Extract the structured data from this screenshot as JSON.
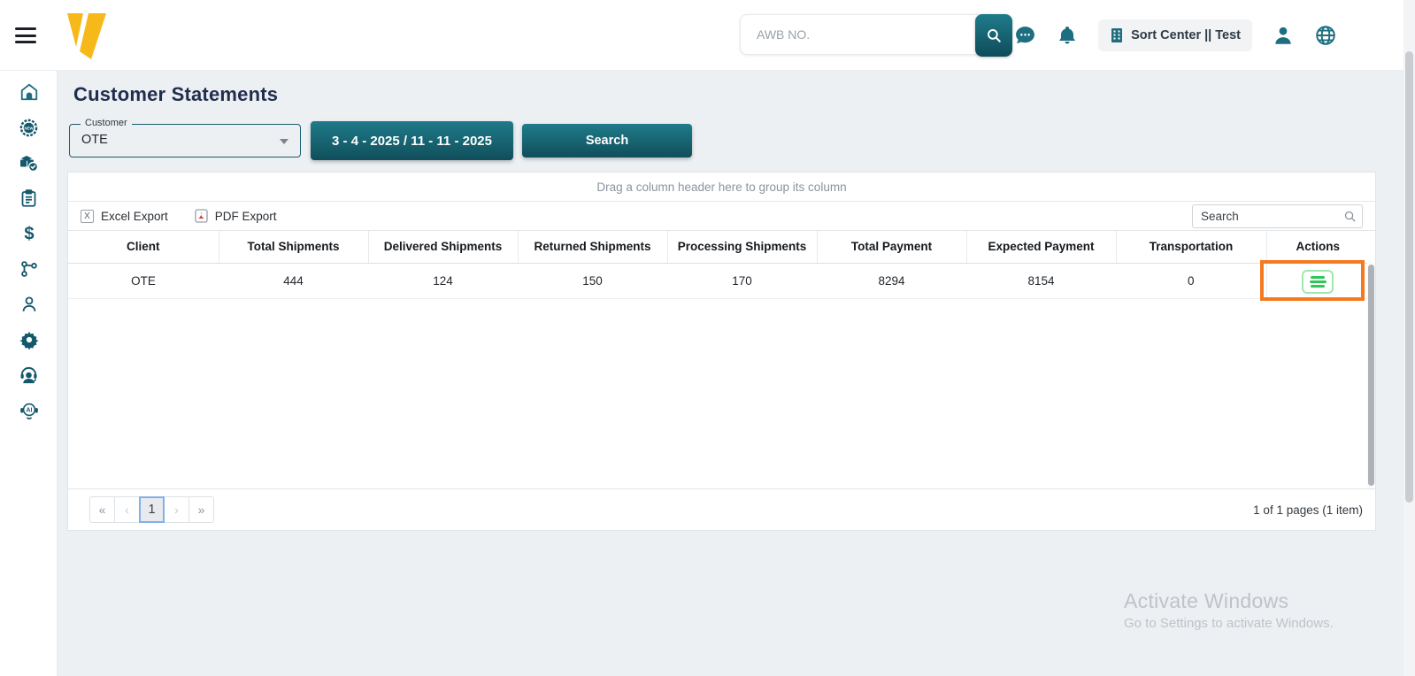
{
  "colors": {
    "accent_teal": "#1F7B8A",
    "dark_teal": "#0F4C59",
    "brand_yellow": "#F7B81A",
    "highlight_orange": "#F4791F",
    "action_green": "#2FC757",
    "title_navy": "#222E4E"
  },
  "topbar": {
    "awb_placeholder": "AWB NO.",
    "station_badge": "Sort Center || Test"
  },
  "page_title": "Customer Statements",
  "filters": {
    "customer_label": "Customer",
    "customer_value": "OTE",
    "date_range_label": "3 - 4 - 2025 / 11 - 11 - 2025",
    "search_label": "Search"
  },
  "grid": {
    "group_hint": "Drag a column header here to group its column",
    "excel_export_label": "Excel Export",
    "excel_icon_letter": "X",
    "pdf_export_label": "PDF Export",
    "search_placeholder": "Search",
    "columns": [
      "Client",
      "Total Shipments",
      "Delivered Shipments",
      "Returned Shipments",
      "Processing Shipments",
      "Total Payment",
      "Expected Payment",
      "Transportation",
      "Actions"
    ],
    "rows": [
      {
        "client": "OTE",
        "total_shipments": "444",
        "delivered_shipments": "124",
        "returned_shipments": "150",
        "processing_shipments": "170",
        "total_payment": "8294",
        "expected_payment": "8154",
        "transportation": "0"
      }
    ],
    "pager": {
      "first": "«",
      "prev": "‹",
      "current_page": "1",
      "next": "›",
      "last": "»",
      "summary": "1 of 1 pages (1 item)"
    }
  },
  "watermark": {
    "title": "Activate Windows",
    "subtitle": "Go to Settings to activate Windows."
  }
}
